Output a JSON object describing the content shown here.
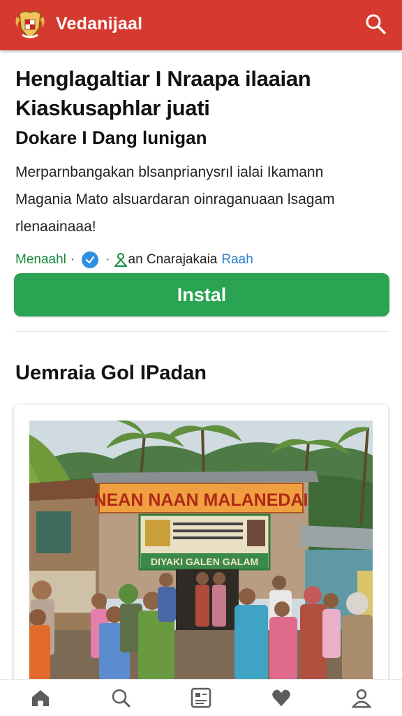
{
  "header": {
    "brand": "Vedanijaal",
    "search_icon": "search-icon",
    "logo_icon": "garuda-emblem-logo",
    "color": "#d63a2f"
  },
  "article": {
    "headline_line1": "Henglagaltiar I Nraapa ilaaian",
    "headline_line2": "Kiaskusaphlar juati",
    "subheadline": "Dokare I Dang lunigan",
    "description": [
      "Merparnbangakan blsanprianysrıl ialai Ikamann",
      "Magania Mato alsuardaran oinraganuaan lsagam",
      "rlenaainaaa!"
    ],
    "meta": {
      "author": "Menaahl",
      "separator": "·",
      "verified_icon": "verified-check-icon",
      "attribution": "an Cnarajakaia",
      "link": "Raah",
      "attribution_icon": "person-icon"
    }
  },
  "install_button": {
    "label": "Instal",
    "color": "#2aa352"
  },
  "gallery": {
    "title": "Uemraia Gol IPadan",
    "photo": {
      "banner_text": "NEAN NAAN MALANEDAI",
      "sign_text": "DIYAKI GALEN GALAM"
    }
  },
  "bottom_nav": {
    "items": [
      "home-icon",
      "search-icon",
      "news-icon",
      "heart-icon",
      "profile-icon"
    ]
  }
}
